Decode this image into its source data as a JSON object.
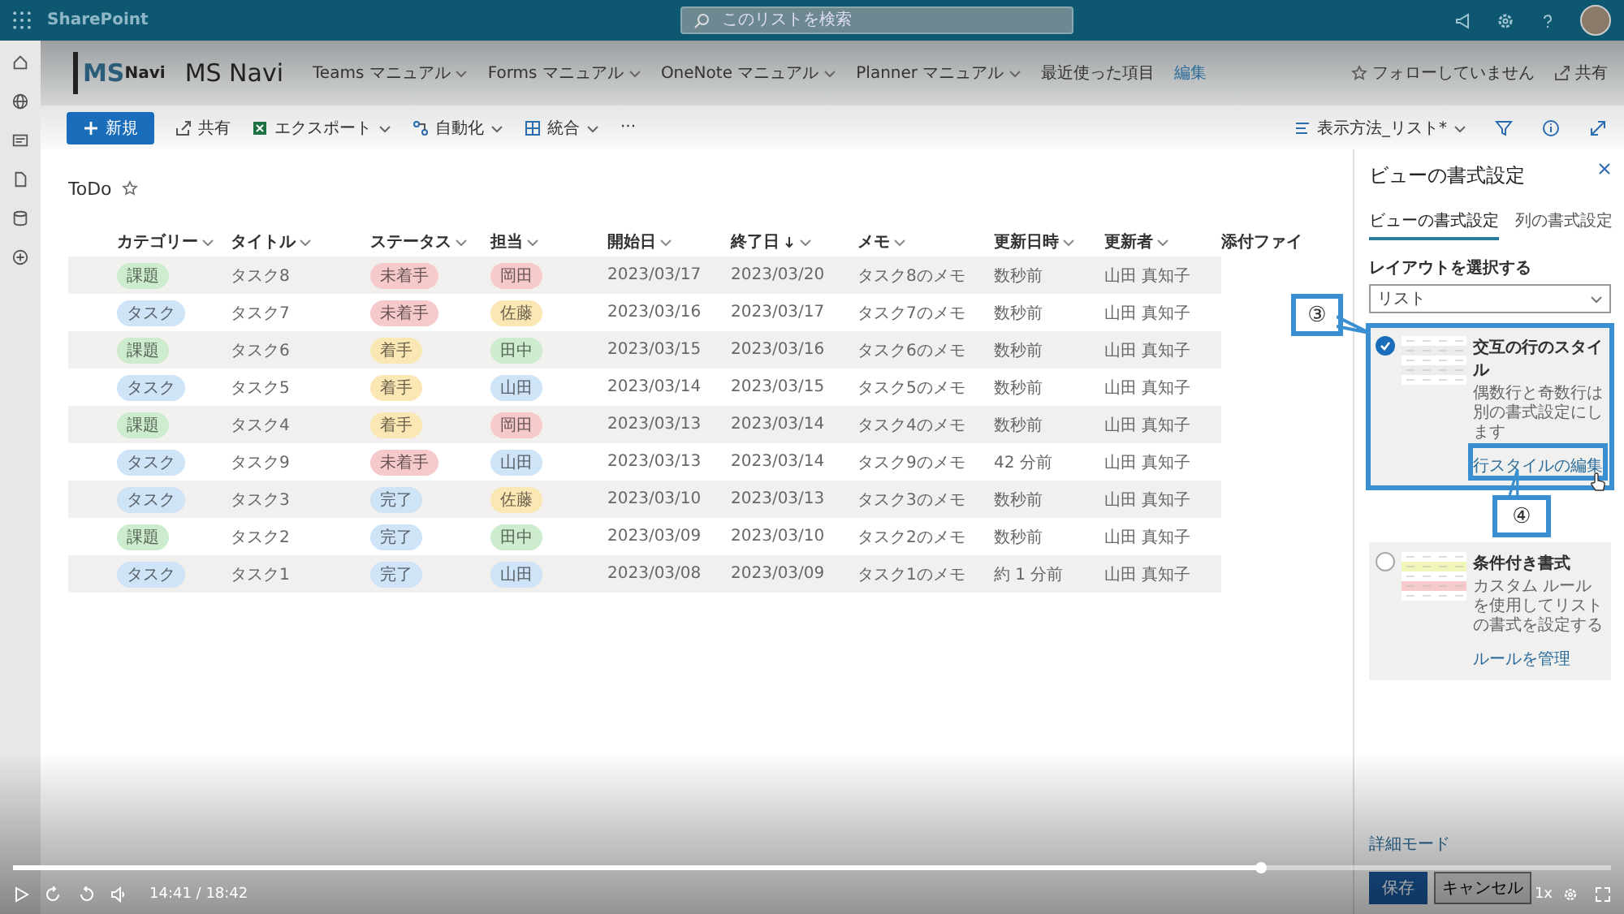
{
  "top_bar": {
    "app_name": "SharePoint",
    "search": {
      "placeholder": "このリストを検索"
    }
  },
  "site_header": {
    "logo": {
      "part_1": "MS",
      "part_2": "Navi"
    },
    "title": "MS Navi",
    "nav": [
      {
        "label": "Teams マニュアル",
        "dropdown": true
      },
      {
        "label": "Forms マニュアル",
        "dropdown": true
      },
      {
        "label": "OneNote マニュアル",
        "dropdown": true
      },
      {
        "label": "Planner マニュアル",
        "dropdown": true
      },
      {
        "label": "最近使った項目",
        "dropdown": false
      },
      {
        "label": "編集",
        "dropdown": false
      }
    ],
    "follow": "フォローしていません",
    "share": "共有"
  },
  "command_bar": {
    "new": "新規",
    "items": [
      {
        "label": "共有",
        "dropdown": false
      },
      {
        "label": "エクスポート",
        "dropdown": true
      },
      {
        "label": "自動化",
        "dropdown": true
      },
      {
        "label": "統合",
        "dropdown": true
      }
    ],
    "more": "···",
    "view": "表示方法_リスト*"
  },
  "list": {
    "title": "ToDo",
    "columns": [
      {
        "label": "カテゴリー",
        "sorted": false,
        "menu": true
      },
      {
        "label": "タイトル",
        "sorted": false,
        "menu": true
      },
      {
        "label": "ステータス",
        "sorted": false,
        "menu": true
      },
      {
        "label": "担当",
        "sorted": false,
        "menu": true
      },
      {
        "label": "開始日",
        "sorted": false,
        "menu": true
      },
      {
        "label": "終了日",
        "sorted": true,
        "menu": true
      },
      {
        "label": "メモ",
        "sorted": false,
        "menu": true
      },
      {
        "label": "更新日時",
        "sorted": false,
        "menu": true
      },
      {
        "label": "更新者",
        "sorted": false,
        "menu": true
      },
      {
        "label": "添付ファイ",
        "sorted": false,
        "menu": false
      }
    ],
    "rows": [
      {
        "category": {
          "text": "課題",
          "color": "#cdeccd"
        },
        "title": "タスク8",
        "status": {
          "text": "未着手",
          "color": "#f6c9cb"
        },
        "assignee": {
          "text": "岡田",
          "color": "#f6c9cb"
        },
        "start": "2023/03/17",
        "end": "2023/03/20",
        "memo": "タスク8のメモ",
        "modified": "数秒前",
        "modified_by": "山田 真知子"
      },
      {
        "category": {
          "text": "タスク",
          "color": "#cfe4f6"
        },
        "title": "タスク7",
        "status": {
          "text": "未着手",
          "color": "#f6c9cb"
        },
        "assignee": {
          "text": "佐藤",
          "color": "#fbe7b4"
        },
        "start": "2023/03/16",
        "end": "2023/03/17",
        "memo": "タスク7のメモ",
        "modified": "数秒前",
        "modified_by": "山田 真知子"
      },
      {
        "category": {
          "text": "課題",
          "color": "#cdeccd"
        },
        "title": "タスク6",
        "status": {
          "text": "着手",
          "color": "#fbe7b4"
        },
        "assignee": {
          "text": "田中",
          "color": "#cdeccd"
        },
        "start": "2023/03/15",
        "end": "2023/03/16",
        "memo": "タスク6のメモ",
        "modified": "数秒前",
        "modified_by": "山田 真知子"
      },
      {
        "category": {
          "text": "タスク",
          "color": "#cfe4f6"
        },
        "title": "タスク5",
        "status": {
          "text": "着手",
          "color": "#fbe7b4"
        },
        "assignee": {
          "text": "山田",
          "color": "#cfe4f6"
        },
        "start": "2023/03/14",
        "end": "2023/03/15",
        "memo": "タスク5のメモ",
        "modified": "数秒前",
        "modified_by": "山田 真知子"
      },
      {
        "category": {
          "text": "課題",
          "color": "#cdeccd"
        },
        "title": "タスク4",
        "status": {
          "text": "着手",
          "color": "#fbe7b4"
        },
        "assignee": {
          "text": "岡田",
          "color": "#f6c9cb"
        },
        "start": "2023/03/13",
        "end": "2023/03/14",
        "memo": "タスク4のメモ",
        "modified": "数秒前",
        "modified_by": "山田 真知子"
      },
      {
        "category": {
          "text": "タスク",
          "color": "#cfe4f6"
        },
        "title": "タスク9",
        "status": {
          "text": "未着手",
          "color": "#f6c9cb"
        },
        "assignee": {
          "text": "山田",
          "color": "#cfe4f6"
        },
        "start": "2023/03/13",
        "end": "2023/03/14",
        "memo": "タスク9のメモ",
        "modified": "42 分前",
        "modified_by": "山田 真知子"
      },
      {
        "category": {
          "text": "タスク",
          "color": "#cfe4f6"
        },
        "title": "タスク3",
        "status": {
          "text": "完了",
          "color": "#cfe4f6"
        },
        "assignee": {
          "text": "佐藤",
          "color": "#fbe7b4"
        },
        "start": "2023/03/10",
        "end": "2023/03/13",
        "memo": "タスク3のメモ",
        "modified": "数秒前",
        "modified_by": "山田 真知子"
      },
      {
        "category": {
          "text": "課題",
          "color": "#cdeccd"
        },
        "title": "タスク2",
        "status": {
          "text": "完了",
          "color": "#cfe4f6"
        },
        "assignee": {
          "text": "田中",
          "color": "#cdeccd"
        },
        "start": "2023/03/09",
        "end": "2023/03/10",
        "memo": "タスク2のメモ",
        "modified": "数秒前",
        "modified_by": "山田 真知子"
      },
      {
        "category": {
          "text": "タスク",
          "color": "#cfe4f6"
        },
        "title": "タスク1",
        "status": {
          "text": "完了",
          "color": "#cfe4f6"
        },
        "assignee": {
          "text": "山田",
          "color": "#cfe4f6"
        },
        "start": "2023/03/08",
        "end": "2023/03/09",
        "memo": "タスク1のメモ",
        "modified": "約 1 分前",
        "modified_by": "山田 真知子"
      }
    ]
  },
  "panel": {
    "title": "ビューの書式設定",
    "tabs": [
      {
        "label": "ビューの書式設定",
        "selected": true
      },
      {
        "label": "列の書式設定",
        "selected": false
      }
    ],
    "layout_label": "レイアウトを選択する",
    "layout_value": "リスト",
    "cards": [
      {
        "kind": "alternating",
        "title": "交互の行のスタイル",
        "description": "偶数行と奇数行は別の書式設定にします",
        "link": "行スタイルの編集",
        "selected": true
      },
      {
        "kind": "conditional",
        "title": "条件付き書式",
        "description": "カスタム ルールを使用してリストの書式を設定する",
        "link": "ルールを管理",
        "selected": false
      }
    ],
    "advanced_link": "詳細モード",
    "save": "保存",
    "cancel": "キャンセル"
  },
  "callouts": [
    {
      "text": "③"
    },
    {
      "text": "④"
    }
  ],
  "player": {
    "time": "14:41 / 18:42",
    "level": 0.78,
    "speed": "1x"
  }
}
